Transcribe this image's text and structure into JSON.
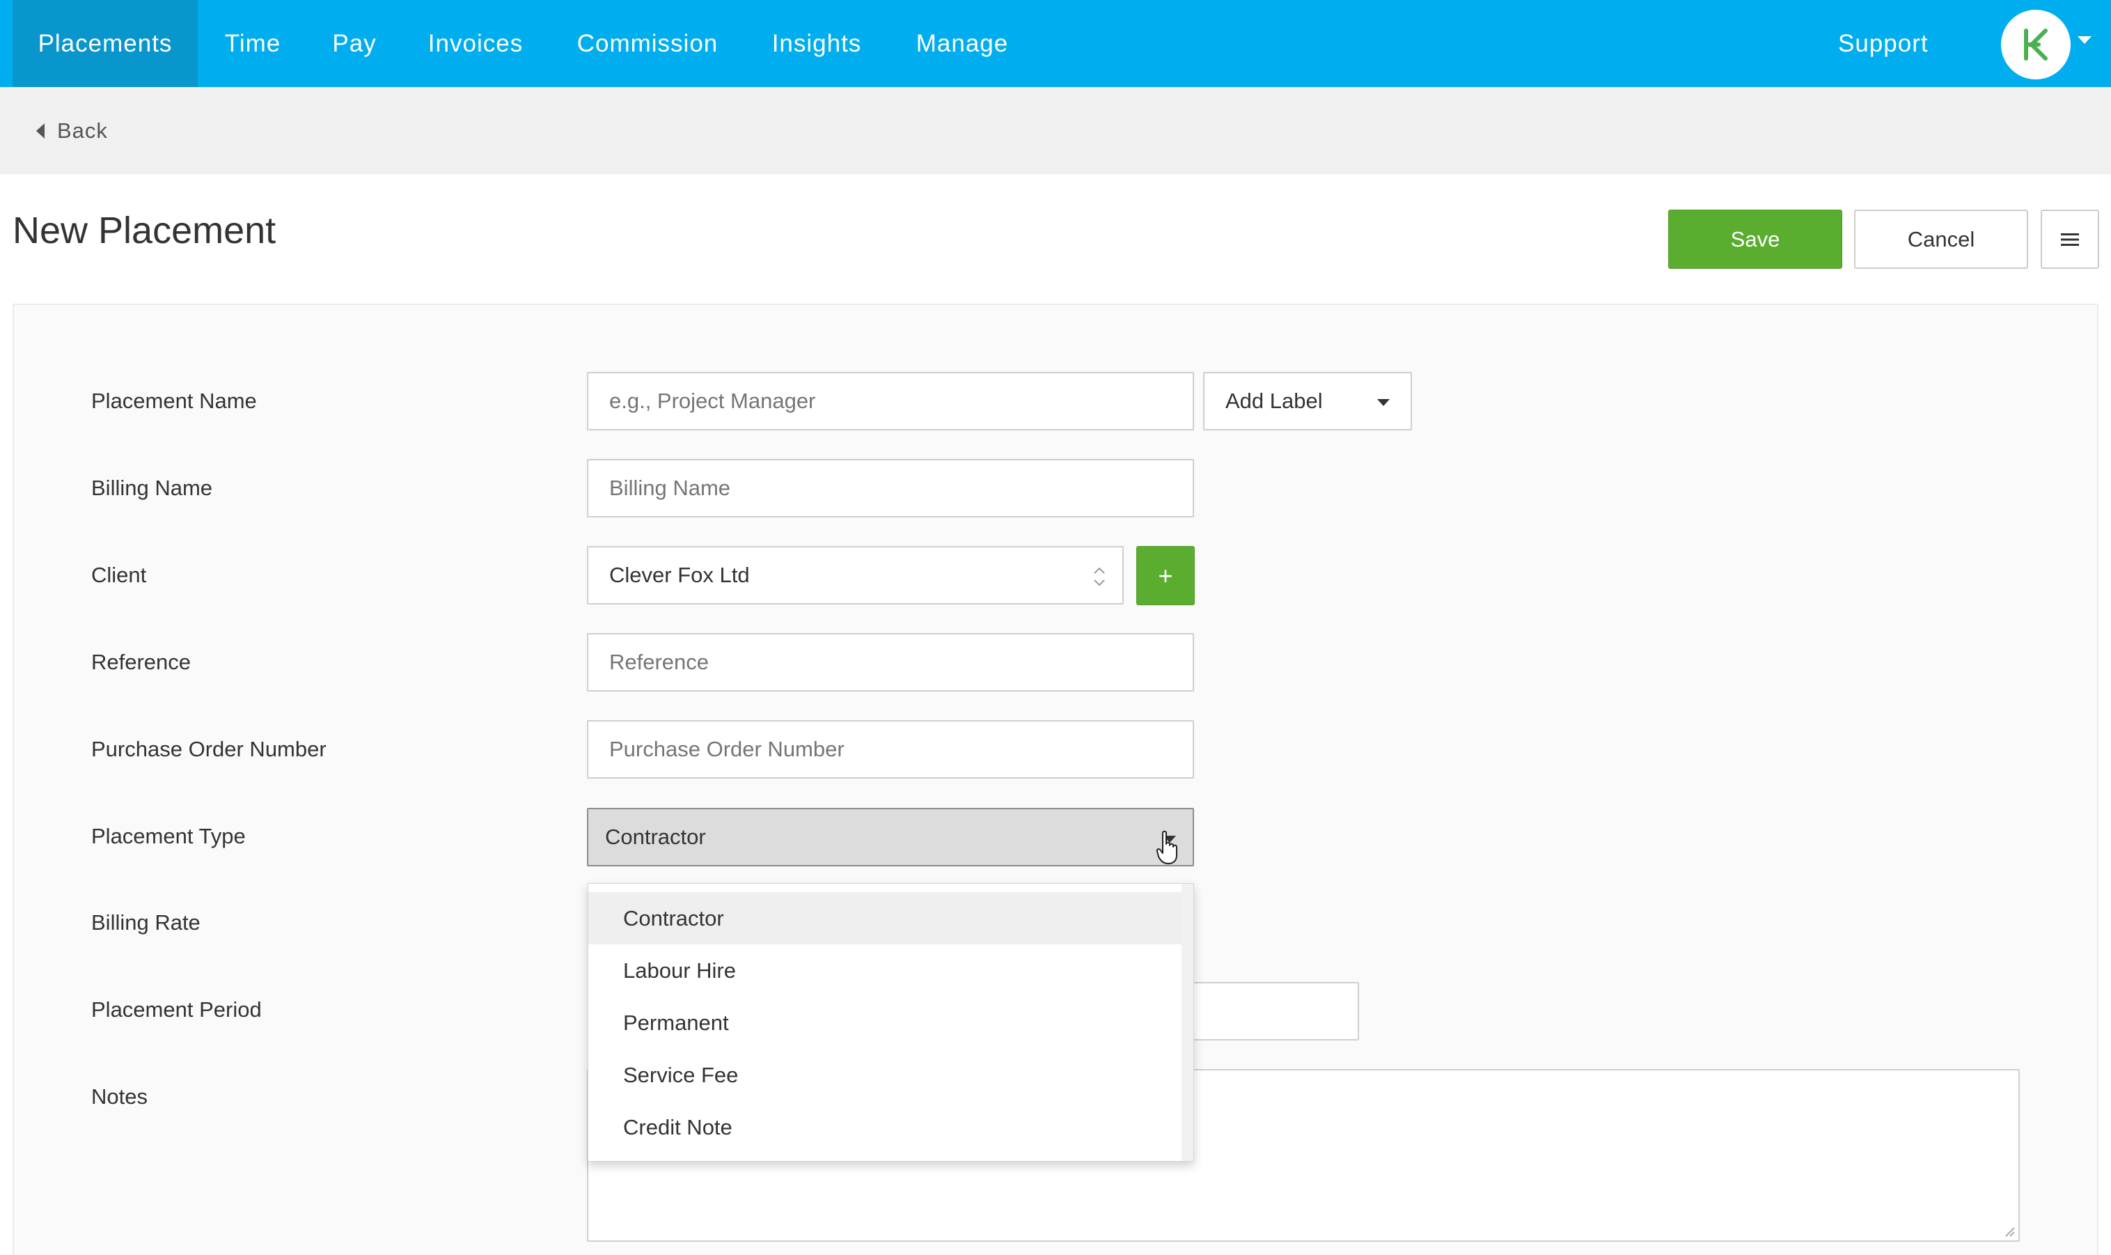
{
  "nav": {
    "items": [
      {
        "label": "Placements",
        "active": true
      },
      {
        "label": "Time"
      },
      {
        "label": "Pay"
      },
      {
        "label": "Invoices"
      },
      {
        "label": "Commission"
      },
      {
        "label": "Insights"
      },
      {
        "label": "Manage"
      }
    ],
    "support_label": "Support",
    "avatar_icon": "k-logo-icon"
  },
  "backbar": {
    "back_label": "Back"
  },
  "header": {
    "title": "New Placement",
    "save_label": "Save",
    "cancel_label": "Cancel",
    "menu_icon": "hamburger-menu-icon"
  },
  "form": {
    "placement_name": {
      "label": "Placement Name",
      "placeholder": "e.g., Project Manager",
      "value": ""
    },
    "add_label": "Add Label",
    "billing_name": {
      "label": "Billing Name",
      "placeholder": "Billing Name",
      "value": ""
    },
    "client": {
      "label": "Client",
      "value": "Clever Fox Ltd"
    },
    "add_client_label": "+",
    "reference": {
      "label": "Reference",
      "placeholder": "Reference",
      "value": ""
    },
    "purchase_order_number": {
      "label": "Purchase Order Number",
      "placeholder": "Purchase Order Number",
      "value": ""
    },
    "placement_type": {
      "label": "Placement Type",
      "value": "Contractor"
    },
    "billing_rate": {
      "label": "Billing Rate"
    },
    "placement_period": {
      "label": "Placement Period"
    },
    "notes": {
      "label": "Notes"
    }
  },
  "dropdown": {
    "options": [
      "Contractor",
      "Labour Hire",
      "Permanent",
      "Service Fee",
      "Credit Note"
    ],
    "highlighted": "Contractor"
  },
  "colors": {
    "nav_bg": "#00aeef",
    "nav_active_bg": "#0996cc",
    "save_green": "#5aad2f",
    "logo_green": "#4caf50"
  }
}
